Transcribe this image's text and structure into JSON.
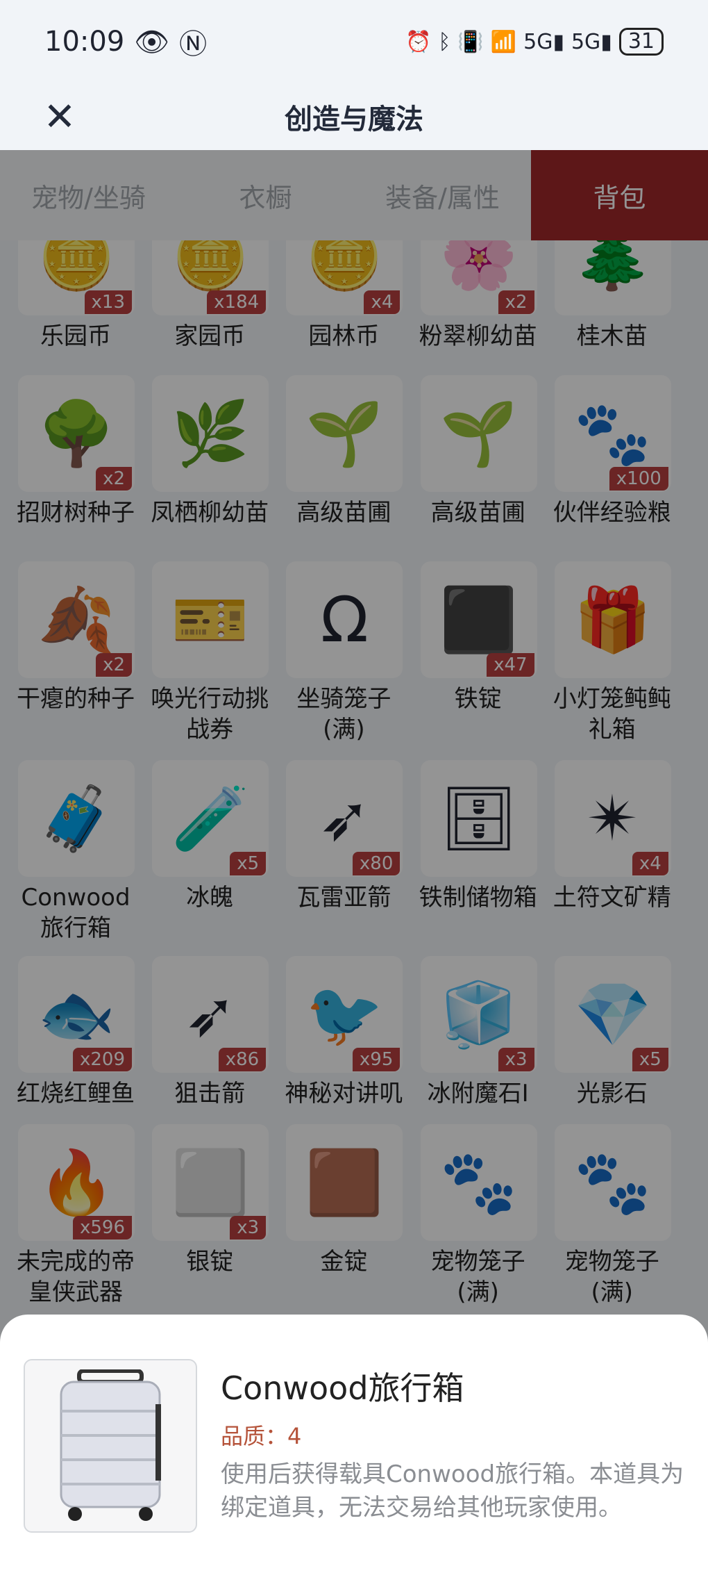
{
  "status": {
    "time": "10:09",
    "battery": "31"
  },
  "header": {
    "title": "创造与魔法"
  },
  "tabs": [
    {
      "label": "宠物/坐骑",
      "active": false
    },
    {
      "label": "衣橱",
      "active": false
    },
    {
      "label": "装备/属性",
      "active": false
    },
    {
      "label": "背包",
      "active": true
    }
  ],
  "grid": [
    [
      {
        "name": "乐园币",
        "count": "x13",
        "icon": "gold-coin-icon",
        "glyph": "🪙",
        "partial": true
      },
      {
        "name": "家园币",
        "count": "x184",
        "icon": "gold-coin-icon",
        "glyph": "🪙",
        "partial": true
      },
      {
        "name": "园林币",
        "count": "x4",
        "icon": "gold-coin-icon",
        "glyph": "🪙",
        "partial": true
      },
      {
        "name": "粉翠柳幼苗",
        "count": "x2",
        "icon": "seed-packet-icon",
        "glyph": "🌸",
        "partial": true
      },
      {
        "name": "桂木苗",
        "count": "",
        "icon": "seed-packet-icon",
        "glyph": "🌲",
        "partial": true
      }
    ],
    [
      {
        "name": "招财树种子",
        "count": "x2",
        "icon": "seed-bag-icon",
        "glyph": "🌳"
      },
      {
        "name": "凤栖柳幼苗",
        "count": "",
        "icon": "seed-packet-icon",
        "glyph": "🌿"
      },
      {
        "name": "高级苗圃",
        "count": "",
        "icon": "garden-fence-icon",
        "glyph": "🌱"
      },
      {
        "name": "高级苗圃",
        "count": "",
        "icon": "garden-fence-icon",
        "glyph": "🌱"
      },
      {
        "name": "伙伴经验粮",
        "count": "x100",
        "icon": "paw-bag-icon",
        "glyph": "🐾"
      }
    ],
    [
      {
        "name": "干瘪的种子",
        "count": "x2",
        "icon": "dried-seed-icon",
        "glyph": "🍂"
      },
      {
        "name": "唤光行动挑战券",
        "count": "",
        "icon": "ticket-icon",
        "glyph": "🎫"
      },
      {
        "name": "坐骑笼子(满)",
        "count": "",
        "icon": "mount-cage-icon",
        "glyph": "Ω"
      },
      {
        "name": "铁锭",
        "count": "x47",
        "icon": "iron-ingot-icon",
        "glyph": "⬛"
      },
      {
        "name": "小灯笼鲀鲀礼箱",
        "count": "",
        "icon": "gift-box-icon",
        "glyph": "🎁"
      }
    ],
    [
      {
        "name": "Conwood旅行箱",
        "count": "",
        "icon": "suitcase-icon",
        "glyph": "🧳"
      },
      {
        "name": "冰魄",
        "count": "x5",
        "icon": "potion-icon",
        "glyph": "🧪"
      },
      {
        "name": "瓦雷亚箭",
        "count": "x80",
        "icon": "arrow-icon",
        "glyph": "➶"
      },
      {
        "name": "铁制储物箱",
        "count": "",
        "icon": "storage-box-icon",
        "glyph": "🗄"
      },
      {
        "name": "土符文矿精",
        "count": "x4",
        "icon": "crystal-icon",
        "glyph": "✴"
      }
    ],
    [
      {
        "name": "红烧红鲤鱼",
        "count": "x209",
        "icon": "fish-dish-icon",
        "glyph": "🐟"
      },
      {
        "name": "狙击箭",
        "count": "x86",
        "icon": "arrow-icon",
        "glyph": "➶"
      },
      {
        "name": "神秘对讲叽",
        "count": "x95",
        "icon": "bird-radio-icon",
        "glyph": "🐦"
      },
      {
        "name": "冰附魔石I",
        "count": "x3",
        "icon": "ice-stone-icon",
        "glyph": "🧊"
      },
      {
        "name": "光影石",
        "count": "x5",
        "icon": "stone-icon",
        "glyph": "💎"
      }
    ],
    [
      {
        "name": "未完成的帝皇侠武器",
        "count": "x596",
        "icon": "fire-weapon-icon",
        "glyph": "🔥"
      },
      {
        "name": "银锭",
        "count": "x3",
        "icon": "silver-ingot-icon",
        "glyph": "⬜"
      },
      {
        "name": "金锭",
        "count": "",
        "icon": "gold-ingot-icon",
        "glyph": "🟫"
      },
      {
        "name": "宠物笼子(满)",
        "count": "",
        "icon": "pet-cage-icon",
        "glyph": "🐾"
      },
      {
        "name": "宠物笼子(满)",
        "count": "",
        "icon": "pet-cage-icon",
        "glyph": "🐾"
      }
    ]
  ],
  "detail": {
    "title": "Conwood旅行箱",
    "quality": "品质：4",
    "description": "使用后获得载具Conwood旅行箱。本道具为绑定道具，无法交易给其他玩家使用。"
  }
}
